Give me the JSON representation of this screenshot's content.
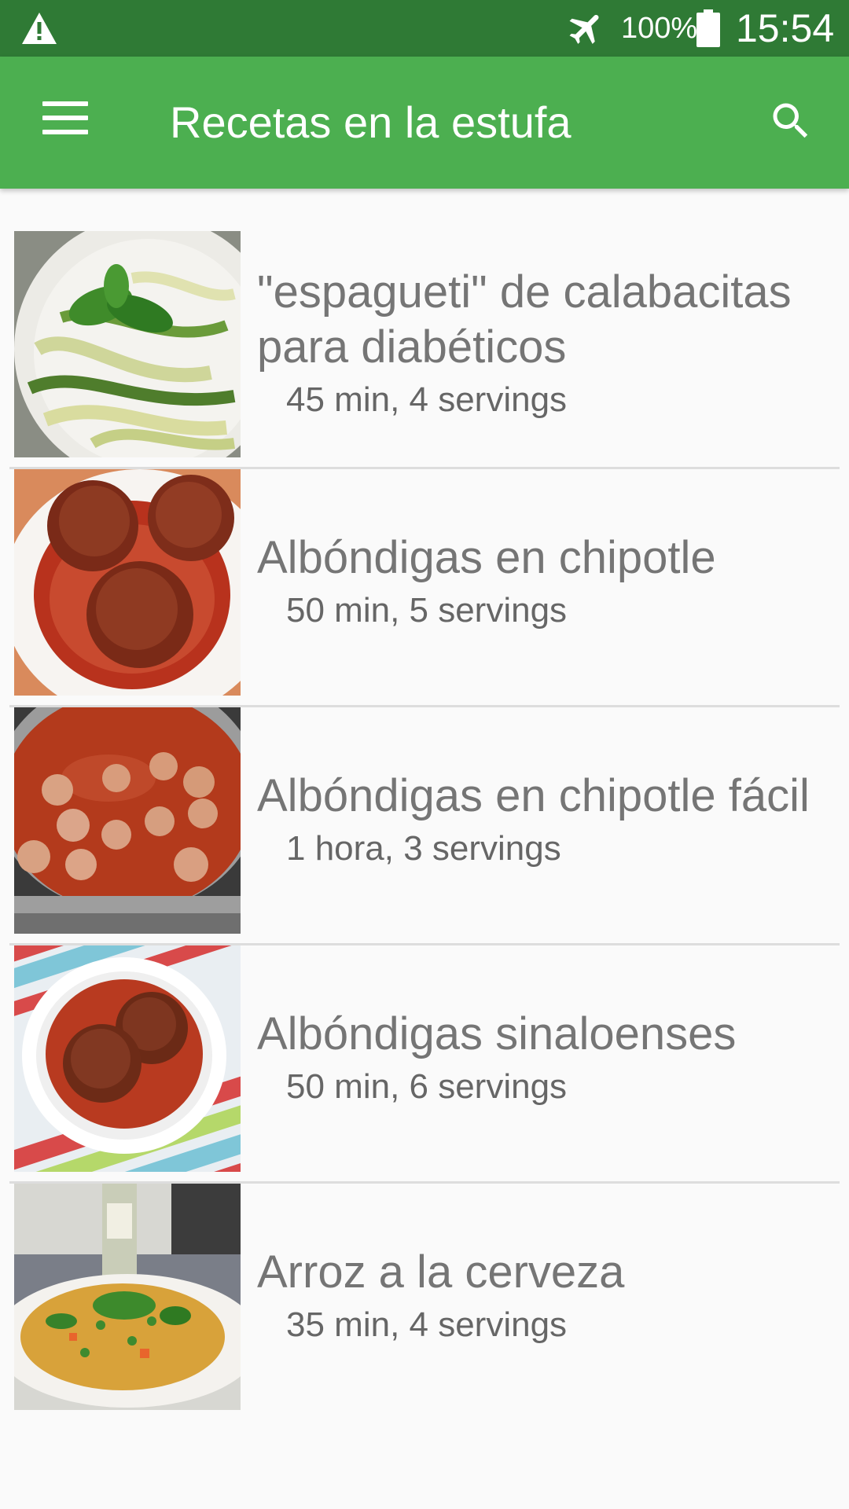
{
  "status_bar": {
    "battery_percent": "100%",
    "time": "15:54",
    "icons": [
      "warning-icon",
      "airplane-mode-icon",
      "battery-icon"
    ]
  },
  "app_bar": {
    "title": "Recetas en la estufa",
    "icons": [
      "menu-icon",
      "search-icon"
    ]
  },
  "recipes": [
    {
      "name": "\"espagueti\" de calabacitas para diabéticos",
      "meta": "45 min, 4 servings"
    },
    {
      "name": "Albóndigas en chipotle",
      "meta": "50 min, 5 servings"
    },
    {
      "name": "Albóndigas en chipotle fácil",
      "meta": "1 hora, 3 servings"
    },
    {
      "name": "Albóndigas sinaloenses",
      "meta": "50 min, 6 servings"
    },
    {
      "name": "Arroz a la cerveza",
      "meta": "35 min, 4 servings"
    }
  ],
  "colors": {
    "status_bar": "#2f7a35",
    "app_bar": "#4caf50",
    "background": "#fafafa",
    "recipe_text": "#757575"
  }
}
